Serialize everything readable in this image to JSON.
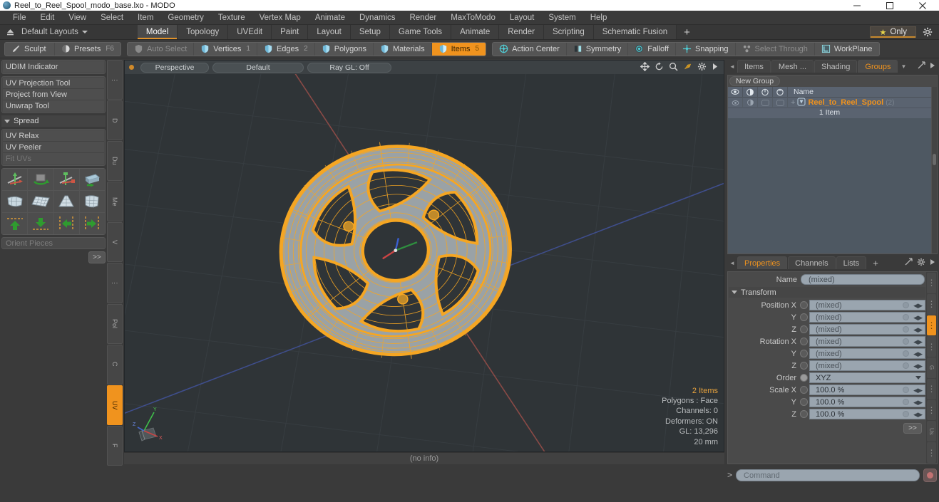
{
  "window": {
    "title": "Reel_to_Reel_Spool_modo_base.lxo - MODO",
    "app_icon": "modo-orb-icon",
    "minimize": "minimize-icon",
    "maximize": "maximize-icon",
    "close": "close-icon"
  },
  "menubar": {
    "items": [
      "File",
      "Edit",
      "View",
      "Select",
      "Item",
      "Geometry",
      "Texture",
      "Vertex Map",
      "Animate",
      "Dynamics",
      "Render",
      "MaxToModo",
      "Layout",
      "System",
      "Help"
    ]
  },
  "layoutbar": {
    "eject_icon": "eject-icon",
    "layouts_label": "Default Layouts",
    "tabs": [
      {
        "label": "Model",
        "active": true
      },
      {
        "label": "Topology",
        "active": false
      },
      {
        "label": "UVEdit",
        "active": false
      },
      {
        "label": "Paint",
        "active": false
      },
      {
        "label": "Layout",
        "active": false
      },
      {
        "label": "Setup",
        "active": false
      },
      {
        "label": "Game Tools",
        "active": false
      },
      {
        "label": "Animate",
        "active": false
      },
      {
        "label": "Render",
        "active": false
      },
      {
        "label": "Scripting",
        "active": false
      },
      {
        "label": "Schematic Fusion",
        "active": false
      }
    ],
    "add_tab": "+",
    "only_label": "Only",
    "only_icon": "star-icon",
    "gear_icon": "gear-icon"
  },
  "modebar": {
    "group1": [
      {
        "label": "Sculpt",
        "icon": "brush-icon",
        "state": "normal",
        "num": ""
      },
      {
        "label": "Presets",
        "icon": "sphere-icon",
        "state": "normal",
        "num": "F6"
      }
    ],
    "group2": [
      {
        "label": "Auto Select",
        "icon": "shield-icon",
        "state": "dim",
        "num": ""
      },
      {
        "label": "Vertices",
        "icon": "shield-icon",
        "state": "normal",
        "num": "1"
      },
      {
        "label": "Edges",
        "icon": "shield-icon",
        "state": "normal",
        "num": "2"
      },
      {
        "label": "Polygons",
        "icon": "shield-icon",
        "state": "normal",
        "num": ""
      },
      {
        "label": "Materials",
        "icon": "shield-icon",
        "state": "normal",
        "num": ""
      },
      {
        "label": "Items",
        "icon": "shield-icon",
        "state": "active",
        "num": "5"
      }
    ],
    "group3": [
      {
        "label": "Action Center",
        "icon": "target-icon",
        "state": "normal",
        "num": ""
      },
      {
        "label": "Symmetry",
        "icon": "mirror-icon",
        "state": "normal",
        "num": ""
      },
      {
        "label": "Falloff",
        "icon": "falloff-icon",
        "state": "normal",
        "num": ""
      },
      {
        "label": "Snapping",
        "icon": "snap-icon",
        "state": "normal",
        "num": ""
      },
      {
        "label": "Select Through",
        "icon": "select-through-icon",
        "state": "dim",
        "num": ""
      },
      {
        "label": "WorkPlane",
        "icon": "workplane-icon",
        "state": "normal",
        "num": ""
      }
    ]
  },
  "leftpanel": {
    "group_a": [
      "UDIM Indicator"
    ],
    "group_b": [
      "UV Projection Tool",
      "Project from View",
      "Unwrap Tool"
    ],
    "spread_header": "Spread",
    "group_c": [
      {
        "label": "UV Relax",
        "dim": false
      },
      {
        "label": "UV Peeler",
        "dim": false
      },
      {
        "label": "Fit UVs",
        "dim": true
      }
    ],
    "icon_rows": [
      [
        "uv-move-icon",
        "uv-rotate-icon",
        "uv-scale-icon",
        "uv-flip-icon"
      ],
      [
        "uv-fit-icon",
        "uv-grid-icon",
        "uv-taper-icon",
        "uv-quad-icon"
      ],
      [
        "uv-up-icon",
        "uv-down-icon",
        "uv-left-icon",
        "uv-right-icon"
      ]
    ],
    "orient_pieces": "Orient Pieces",
    "more_button": ">>",
    "vtabs": [
      {
        "label": "⋮",
        "active": false
      },
      {
        "label": "D",
        "active": false
      },
      {
        "label": "Du",
        "active": false
      },
      {
        "label": "Me",
        "active": false
      },
      {
        "label": "V",
        "active": false
      },
      {
        "label": "⋮",
        "active": false
      },
      {
        "label": "Pol",
        "active": false
      },
      {
        "label": "C",
        "active": false
      },
      {
        "label": "UV",
        "active": true
      },
      {
        "label": "F",
        "active": false
      }
    ]
  },
  "viewport": {
    "dot_color": "#d08a2a",
    "pills": [
      "Perspective",
      "Default",
      "Ray GL: Off"
    ],
    "nav_icons": [
      "pan-icon",
      "rotate-icon",
      "zoom-icon",
      "fit-icon",
      "viewport-gear-icon",
      "viewport-arrow-icon"
    ],
    "stats": {
      "items": "2 Items",
      "polygons": "Polygons : Face",
      "channels": "Channels: 0",
      "deformers": "Deformers: ON",
      "gl": "GL: 13,296",
      "scale": "20 mm"
    },
    "gizmo_labels": {
      "x": "X",
      "y": "Y",
      "z": "Z"
    },
    "status": "(no info)",
    "mesh_name": "reel-to-reel-spool-wireframe",
    "wire_color": "#f5a623",
    "surface_color": "#9aa2a6",
    "background_color": "#2f3437"
  },
  "rightpanel": {
    "top_tabs": [
      {
        "label": "Items",
        "active": false
      },
      {
        "label": "Mesh ...",
        "active": false
      },
      {
        "label": "Shading",
        "active": false
      },
      {
        "label": "Groups",
        "active": true
      }
    ],
    "top_tab_caret": "chevron-down-icon",
    "top_expand_icon": "expand-icon",
    "top_arrow_icon": "chevron-right-icon",
    "new_group_button": "New Group",
    "tree_columns": [
      "eye-icon",
      "render-icon",
      "lock-icon",
      "select-icon"
    ],
    "tree_name_header": "Name",
    "tree_item": {
      "label": "Reel_to_Reel_Spool",
      "count": "(2)",
      "icon": "group-item-icon",
      "expander": "+",
      "sub_label": "1 Item"
    },
    "prop_tabs": [
      {
        "label": "Properties",
        "active": true
      },
      {
        "label": "Channels",
        "active": false
      },
      {
        "label": "Lists",
        "active": false
      }
    ],
    "prop_tab_plus": "+",
    "prop_expand_icon": "expand-icon",
    "prop_gear_icon": "gear-icon",
    "prop_arrow_icon": "chevron-right-icon",
    "name_label": "Name",
    "name_value": "(mixed)",
    "transform_header": "Transform",
    "transform_rows": [
      {
        "label": "Position X",
        "value": "(mixed)",
        "type": "num",
        "filled": false
      },
      {
        "label": "Y",
        "value": "(mixed)",
        "type": "num",
        "filled": false
      },
      {
        "label": "Z",
        "value": "(mixed)",
        "type": "num",
        "filled": false
      },
      {
        "label": "Rotation X",
        "value": "(mixed)",
        "type": "num",
        "filled": false
      },
      {
        "label": "Y",
        "value": "(mixed)",
        "type": "num",
        "filled": false
      },
      {
        "label": "Z",
        "value": "(mixed)",
        "type": "num",
        "filled": false
      },
      {
        "label": "Order",
        "value": "XYZ",
        "type": "dropdown",
        "filled": true
      },
      {
        "label": "Scale X",
        "value": "100.0 %",
        "type": "num",
        "filled": false
      },
      {
        "label": "Y",
        "value": "100.0 %",
        "type": "num",
        "filled": false
      },
      {
        "label": "Z",
        "value": "100.0 %",
        "type": "num",
        "filled": false
      }
    ],
    "more_button": ">>",
    "side_tabs": [
      {
        "label": "⋮",
        "active": false
      },
      {
        "label": "⋮",
        "active": false
      },
      {
        "label": "⋮",
        "active": true
      },
      {
        "label": "⋮",
        "active": false
      },
      {
        "label": "G",
        "active": false
      },
      {
        "label": "⋮",
        "active": false
      },
      {
        "label": "⋮",
        "active": false
      },
      {
        "label": "Us",
        "active": false
      },
      {
        "label": "⋮",
        "active": false
      }
    ]
  },
  "commandbar": {
    "prompt": ">",
    "placeholder": "Command",
    "record_icon": "record-icon"
  }
}
